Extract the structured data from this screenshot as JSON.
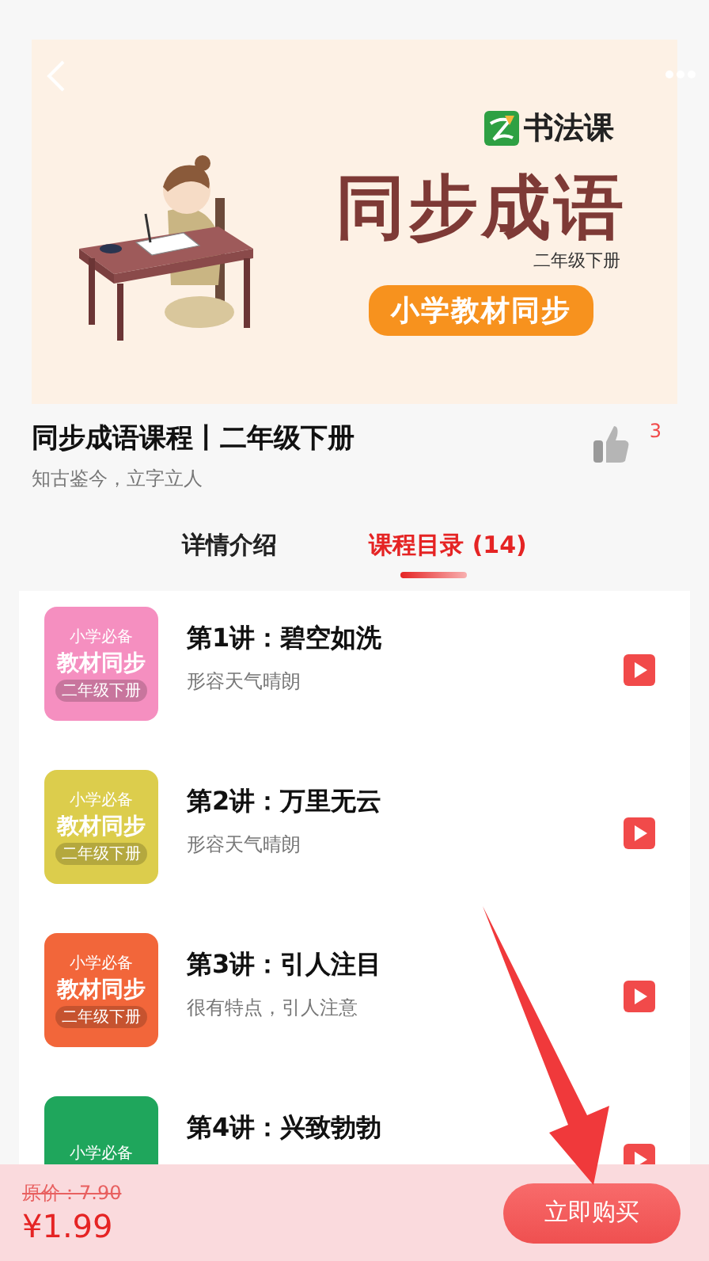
{
  "banner": {
    "brand": "书法课",
    "title": "同步成语",
    "grade": "二年级下册",
    "badge": "小学教材同步"
  },
  "course": {
    "title": "同步成语课程丨二年级下册",
    "subtitle": "知古鉴今，立字立人",
    "likes": "3"
  },
  "tabs": [
    {
      "label": "详情介绍",
      "selected": false
    },
    {
      "label": "课程目录 (14)",
      "selected": true
    }
  ],
  "lessons": [
    {
      "title": "第1讲：碧空如洗",
      "subtitle": "形容天气晴朗",
      "color": "#f58fc0",
      "thumb_texts": [
        "小学必备",
        "教材同步",
        "二年级下册"
      ]
    },
    {
      "title": "第2讲：万里无云",
      "subtitle": "形容天气晴朗",
      "color": "#dccd4c",
      "thumb_texts": [
        "小学必备",
        "教材同步",
        "二年级下册"
      ]
    },
    {
      "title": "第3讲：引人注目",
      "subtitle": "很有特点，引人注意",
      "color": "#f2663a",
      "thumb_texts": [
        "小学必备",
        "教材同步",
        "二年级下册"
      ]
    },
    {
      "title": "第4讲：兴致勃勃",
      "color": "#1fa65c",
      "thumb_texts": [
        "小学必备"
      ]
    }
  ],
  "purchase": {
    "original_price": "原价：7.90",
    "price": "¥1.99",
    "button": "立即购买"
  }
}
